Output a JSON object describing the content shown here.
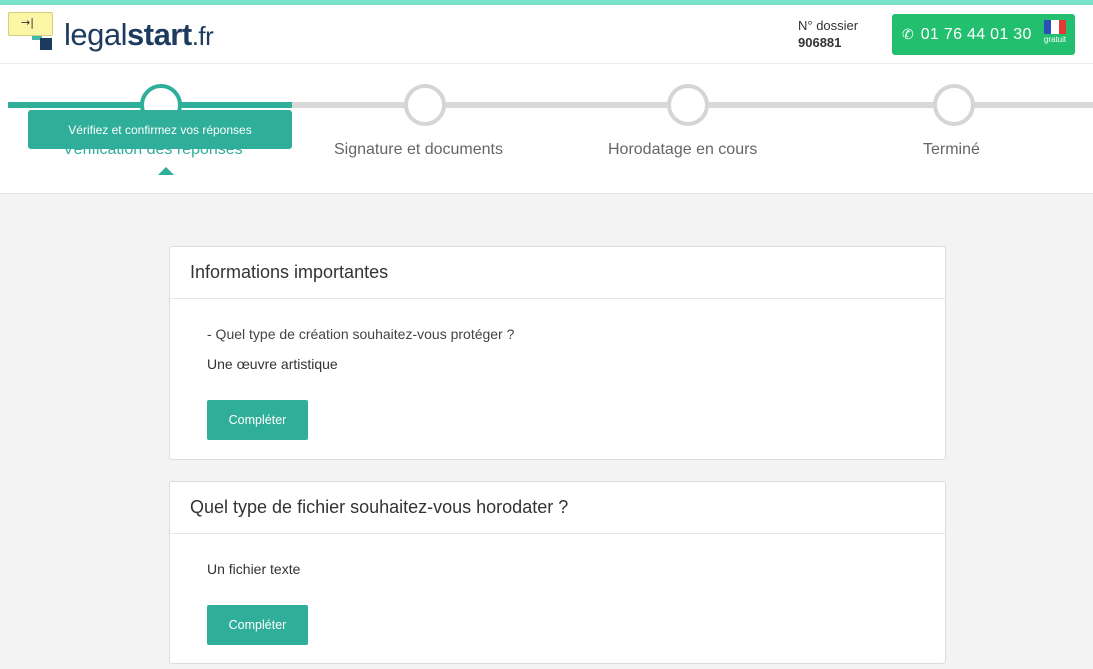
{
  "header": {
    "sidebar_toggle": "→|",
    "logo": {
      "part_light": "legal",
      "part_bold": "start",
      "part_tld": ".fr"
    },
    "dossier_label": "N° dossier",
    "dossier_number": "906881",
    "phone": {
      "number": "01 76 44 01 30",
      "icon": "phone-icon",
      "free_label": "gratuit"
    },
    "flag_colors": [
      "#2a4fb8",
      "#ffffff",
      "#e53935"
    ]
  },
  "stepper": {
    "steps": [
      {
        "label": "Vérification des réponses",
        "state": "active"
      },
      {
        "label": "Signature et documents",
        "state": "todo"
      },
      {
        "label": "Horodatage en cours",
        "state": "todo"
      },
      {
        "label": "Terminé",
        "state": "todo"
      }
    ],
    "tooltip": "Vérifiez et confirmez vos réponses"
  },
  "cards": [
    {
      "title": "Informations importantes",
      "question": "- Quel type de création souhaitez-vous protéger ?",
      "answer": "Une œuvre artistique",
      "button": "Compléter"
    },
    {
      "title": "Quel type de fichier souhaitez-vous horodater ?",
      "answer": "Un fichier texte",
      "button": "Compléter"
    }
  ],
  "colors": {
    "accent": "#2fae9a",
    "phone_green": "#22c06e",
    "brand_navy": "#1d3a5f",
    "top_bar": "#7be0c9"
  }
}
